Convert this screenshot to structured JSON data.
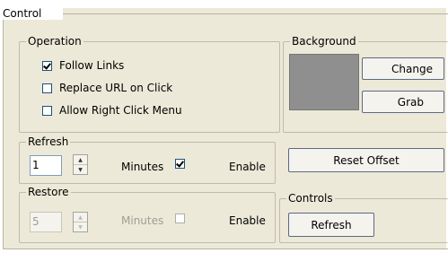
{
  "window": {
    "title": "Control"
  },
  "operation": {
    "title": "Operation",
    "options": [
      {
        "label": "Follow Links",
        "checked": true
      },
      {
        "label": "Replace URL on Click",
        "checked": false
      },
      {
        "label": "Allow Right Click Menu",
        "checked": false
      }
    ]
  },
  "background": {
    "title": "Background",
    "swatch_color": "#8f8f8f",
    "change_label": "Change",
    "grab_label": "Grab",
    "reset_label": "Reset Offset"
  },
  "refresh": {
    "title": "Refresh",
    "value": "1",
    "minutes_label": "Minutes",
    "enable_label": "Enable",
    "enabled": true
  },
  "restore": {
    "title": "Restore",
    "value": "5",
    "minutes_label": "Minutes",
    "enable_label": "Enable",
    "enabled": false
  },
  "controls": {
    "title": "Controls",
    "refresh_label": "Refresh"
  }
}
